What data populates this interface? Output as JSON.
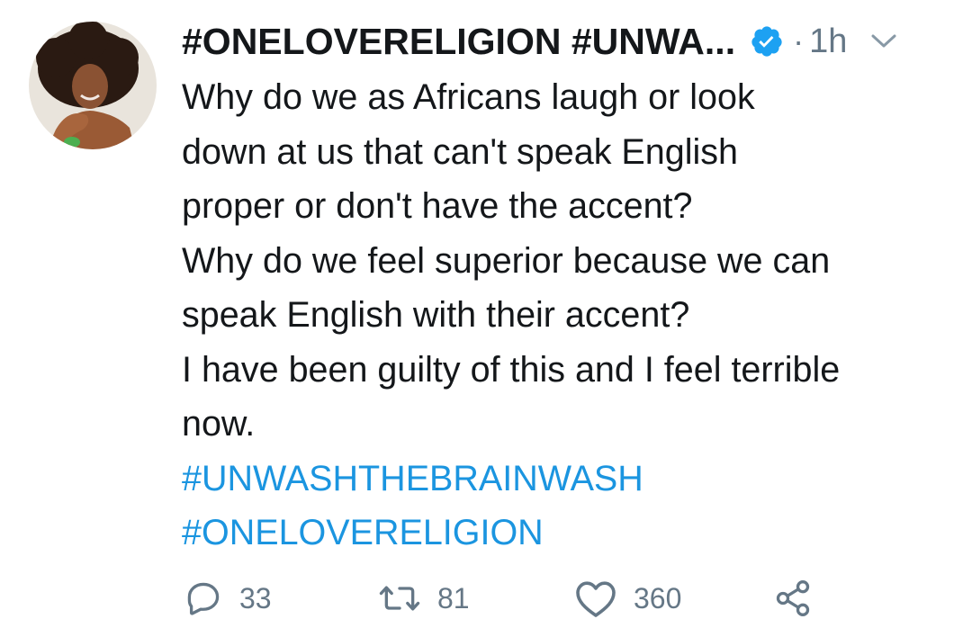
{
  "tweet": {
    "display_name": "#ONELOVERELIGION #UNWA...",
    "verified": true,
    "separator": "·",
    "time": "1h",
    "lines": [
      "Why do we as Africans laugh or look",
      "down at us that can't speak English",
      "proper or don't have the accent?",
      "Why do we feel superior because we can",
      "speak English with their accent?",
      "I have been guilty of this and I feel terrible",
      "now."
    ],
    "hashtags": [
      "#UNWASHTHEBRAINWASH",
      "#ONELOVERELIGION"
    ]
  },
  "actions": {
    "replies": "33",
    "retweets": "81",
    "likes": "360"
  },
  "icons": {
    "verified": "verified-badge-icon",
    "menu": "chevron-down-icon",
    "reply": "reply-icon",
    "retweet": "retweet-icon",
    "like": "heart-icon",
    "share": "share-icon"
  },
  "colors": {
    "text": "#14171a",
    "secondary": "#657786",
    "link": "#1b95e0",
    "verified": "#1da1f2"
  }
}
